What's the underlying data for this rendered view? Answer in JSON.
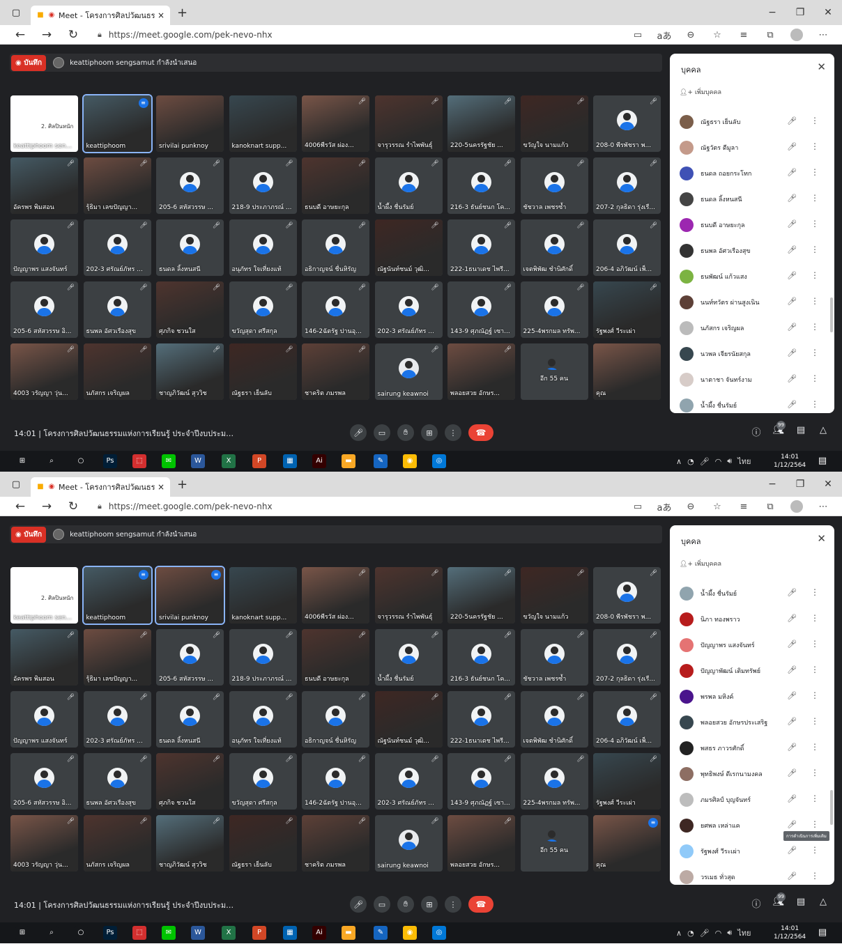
{
  "browser": {
    "tab_title": "Meet - โครงการศิลปวัฒนธรรม",
    "url": "https://meet.google.com/pek-nevo-nhx",
    "new_tab": "+",
    "close_tab": "×",
    "read_aloud": "aあ"
  },
  "meet": {
    "record_label": "บันทึก",
    "presenter_text": "keattiphoom sengsamut กำลังนำเสนอ",
    "time": "14:01",
    "meeting_title": "โครงการศิลปวัฒนธรรมแห่งการเรียนรู้ ประจำปีงบประมาณ พ...",
    "participant_badge": "99",
    "panel_title": "บุคคล",
    "add_people": "เพิ่มบุคคล",
    "tooltip": "การดำเนินการเพิ่มเติม",
    "slide_text": "2. ศิลปินหนัก"
  },
  "taskbar": {
    "lang": "ไทย",
    "clock": "14:01",
    "date": "1/12/2564"
  },
  "tiles": [
    {
      "name": "keattiphoom sen...",
      "pic": "slide"
    },
    {
      "name": "keattiphoom",
      "pic": "photo"
    },
    {
      "name": "srivilai punknoy",
      "pic": "photo"
    },
    {
      "name": "kanoknart supp...",
      "pic": "photo"
    },
    {
      "name": "4006พีรวัส ผ่อง...",
      "pic": "photo"
    },
    {
      "name": "จารุวรรณ รำไพพันธุ์",
      "pic": "photo"
    },
    {
      "name": "220-5นครรัฐชัย ...",
      "pic": "photo"
    },
    {
      "name": "ขวัญใจ นามแก้ว",
      "pic": "photo"
    },
    {
      "name": "208-0 พีรพัชรา พ...",
      "pic": "avatar"
    },
    {
      "name": "อัครพร พิมสอน",
      "pic": "photo"
    },
    {
      "name": "รุ้ธิมา เลขปัญญา...",
      "pic": "photo"
    },
    {
      "name": "205-6 สหัสวรรษ ...",
      "pic": "avatar"
    },
    {
      "name": "218-9 ประภาภรณ์ ...",
      "pic": "avatar"
    },
    {
      "name": "ธนบดี อาษยะกุล",
      "pic": "photo"
    },
    {
      "name": "น้ำผึ้ง ชื่นรัมย์",
      "pic": "avatar"
    },
    {
      "name": "216-3 ธันย์ชนก โค...",
      "pic": "avatar"
    },
    {
      "name": "ชัชวาล เพชรซ้ำ",
      "pic": "avatar"
    },
    {
      "name": "207-2 กุลธิดา รุ่งเรื...",
      "pic": "avatar"
    },
    {
      "name": "ปัญญาพร แสงจันทร์",
      "pic": "avatar"
    },
    {
      "name": "202-3 ศรัณย์ภัทร ...",
      "pic": "avatar"
    },
    {
      "name": "ธนดล ลิ้งหนสนี",
      "pic": "avatar"
    },
    {
      "name": "อนุภัทร ใจเที่ยงแท้",
      "pic": "avatar"
    },
    {
      "name": "อธิกาญจน์ ชื่นหิรัญ",
      "pic": "avatar"
    },
    {
      "name": "ณัฐนันท์ชนม์ วุฒิ...",
      "pic": "photo"
    },
    {
      "name": "222-1ธนาเดช ไพรี...",
      "pic": "avatar"
    },
    {
      "name": "เจตพิพัฒ ชำนิศักดิ์",
      "pic": "avatar"
    },
    {
      "name": "206-4 อภิวัฒน์ เพ็...",
      "pic": "avatar"
    },
    {
      "name": "205-6 สหัสวรรษ อิ...",
      "pic": "avatar"
    },
    {
      "name": "ธนพล อัศวเรืองสุข",
      "pic": "avatar"
    },
    {
      "name": "ศุภกิจ ชวนใส",
      "pic": "photo"
    },
    {
      "name": "ขวัญสุดา ศรีสกุล",
      "pic": "avatar"
    },
    {
      "name": "146-2ฉัตรัฐ ปานอุ...",
      "pic": "avatar"
    },
    {
      "name": "202-3 ศรัณย์ภัทร ...",
      "pic": "avatar"
    },
    {
      "name": "143-9 ศุภณัฏฐ์ เซา...",
      "pic": "avatar"
    },
    {
      "name": "225-4พรกมล ทรัพ...",
      "pic": "avatar"
    },
    {
      "name": "รัฐพงศ์ วีระเผ่า",
      "pic": "photo"
    },
    {
      "name": "4003 วรัญญา วุ่น...",
      "pic": "photo"
    },
    {
      "name": "นภัสกร เจริญผล",
      "pic": "photo"
    },
    {
      "name": "ชาญภิวัฒน์ สุววิช",
      "pic": "photo"
    },
    {
      "name": "ณัฐธรา เย็นลับ",
      "pic": "photo"
    },
    {
      "name": "ชาคริต ภมรพล",
      "pic": "photo"
    },
    {
      "name": "sairung keawnoi",
      "pic": "blank"
    },
    {
      "name": "พลอยสวย อักษร...",
      "pic": "photo"
    },
    {
      "name": "อีก 55 คน",
      "pic": "more"
    },
    {
      "name": "คุณ",
      "pic": "photo"
    }
  ],
  "panel1": [
    {
      "name": "ณัฐธรา เย็นลับ",
      "color": "#7b5e4a"
    },
    {
      "name": "ณัฐวัตร ดีมูลา",
      "color": "#c49a8a"
    },
    {
      "name": "ธนดล ถอยกระโทก",
      "color": "#3f51b5"
    },
    {
      "name": "ธนดล ลิ้งหนสนี",
      "color": "#444"
    },
    {
      "name": "ธนบดี อาษยะกุล",
      "color": "#9c27b0"
    },
    {
      "name": "ธนพล อัศวเรืองสุข",
      "color": "#333"
    },
    {
      "name": "ธนพัฒน์ แก้วแสง",
      "color": "#7cb342"
    },
    {
      "name": "นนท์ทวัตร ผ่านสูงเนิน",
      "color": "#5d4037"
    },
    {
      "name": "นภัสกร เจริญผล",
      "color": "#bbb"
    },
    {
      "name": "นวพล เจียรนัยสกุล",
      "color": "#37474f"
    },
    {
      "name": "นาตาชา จันทร์งาม",
      "color": "#d7ccc8"
    },
    {
      "name": "น้ำผึ้ง ชื่นรัมย์",
      "color": "#90a4ae"
    }
  ],
  "panel2": [
    {
      "name": "น้ำผึ้ง ชื่นรัมย์",
      "color": "#90a4ae"
    },
    {
      "name": "นิภา ทองพราว",
      "color": "#b71c1c"
    },
    {
      "name": "ปัญญาพร แสงจันทร์",
      "color": "#e57373"
    },
    {
      "name": "ปัญญาพัฒน์ เติมทรัพย์",
      "color": "#b71c1c"
    },
    {
      "name": "พรพล มหิงค์",
      "color": "#4a148c"
    },
    {
      "name": "พลอยสวย อักษรประเสริฐ",
      "color": "#37474f"
    },
    {
      "name": "พสธร ภาวรศักดิ์",
      "color": "#222"
    },
    {
      "name": "พุทธิพงษ์ ดีเรกนามงคล",
      "color": "#8d6e63"
    },
    {
      "name": "ภมรศิลป์ บุญจันทร์",
      "color": "#bdbdbd"
    },
    {
      "name": "ยศพล เหล่าแค",
      "color": "#3e2723"
    },
    {
      "name": "รัฐพงศ์ วีระเผ่า",
      "color": "#90caf9"
    },
    {
      "name": "วรเมธ ทั่วสุด",
      "color": "#bcaaa4"
    }
  ],
  "colors": {
    "meet_bg": "#202124",
    "tile_bg": "#3c4043",
    "hangup": "#ea4335",
    "record": "#d93025",
    "accent": "#1a73e8"
  }
}
